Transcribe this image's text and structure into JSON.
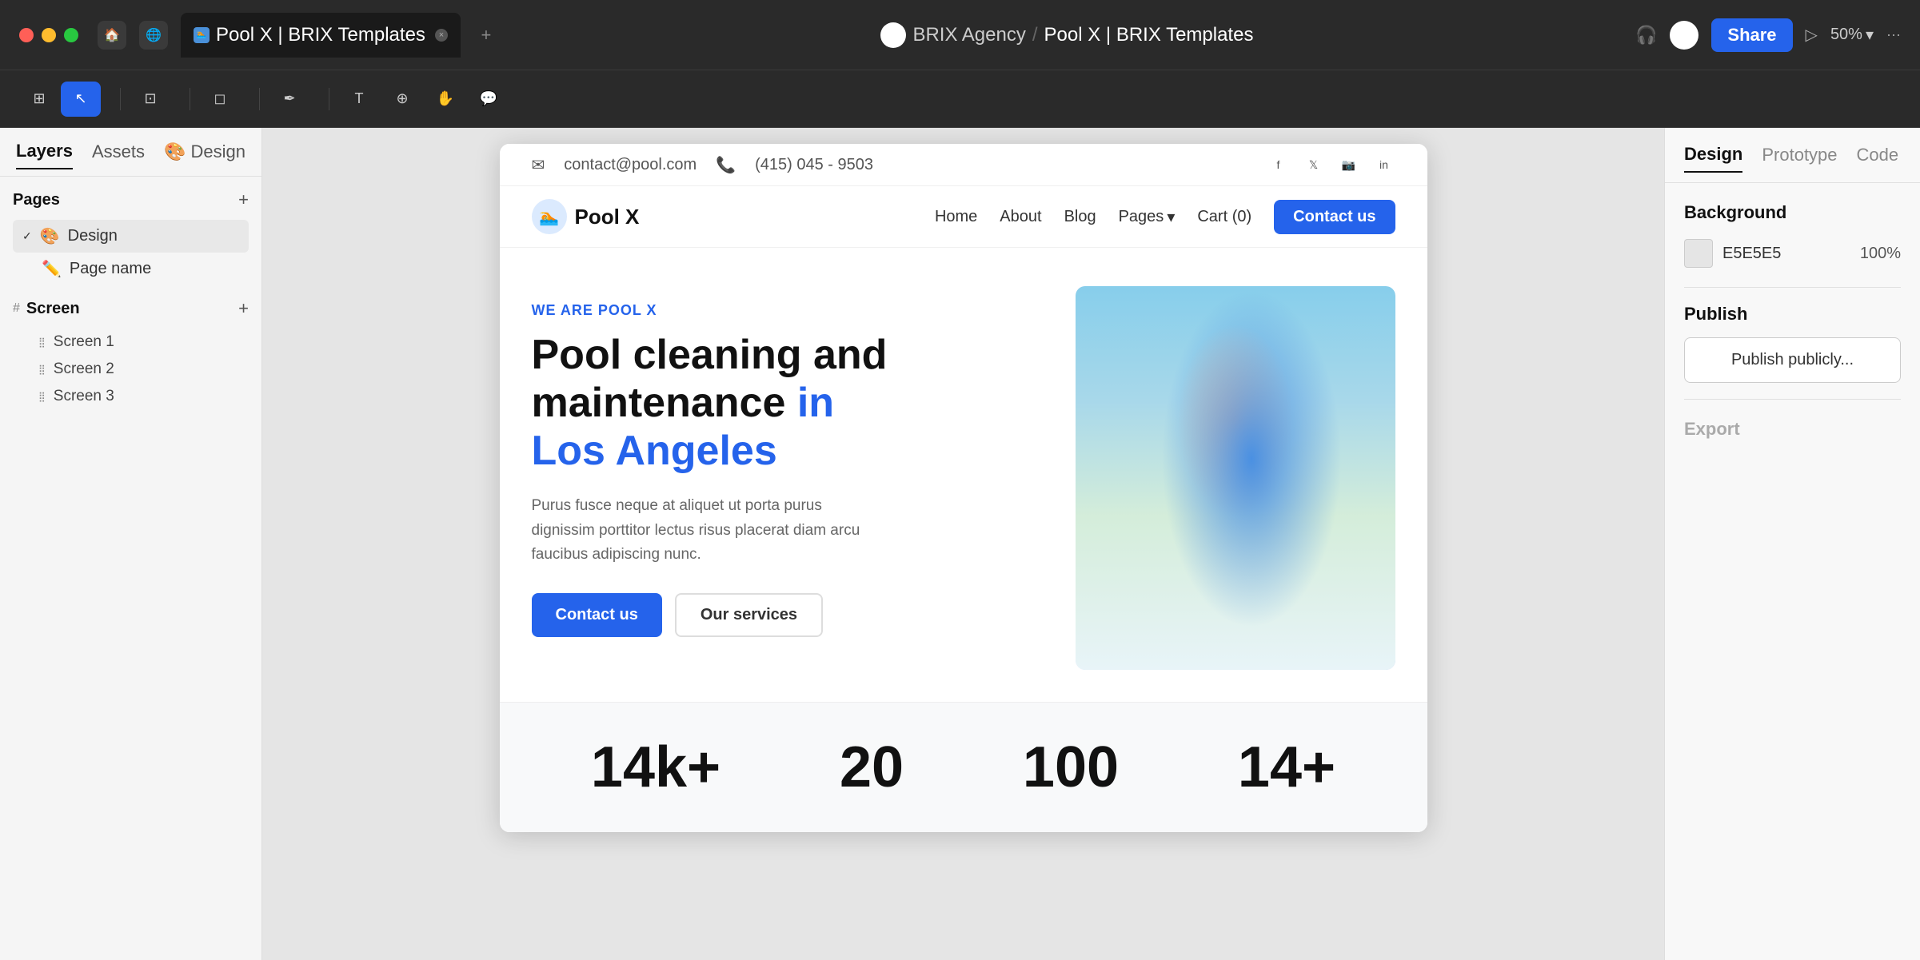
{
  "titlebar": {
    "tab_title": "Pool X | BRIX Templates",
    "tab_close": "×",
    "tab_add": "+",
    "breadcrumb_workspace": "BRIX Agency",
    "breadcrumb_sep": "/",
    "breadcrumb_page": "Pool X | BRIX Templates",
    "share_label": "Share",
    "zoom_label": "50%",
    "more": "···"
  },
  "toolbar": {
    "tools": [
      "grid",
      "cursor",
      "frame",
      "shape",
      "pen",
      "text",
      "components",
      "hand",
      "comment"
    ]
  },
  "sidebar": {
    "tabs": [
      "Layers",
      "Assets",
      "Design"
    ],
    "active_tab": "Layers",
    "pages_label": "Pages",
    "pages_add": "+",
    "design_page_label": "Design",
    "page_name_label": "Page name",
    "screen_label": "Screen",
    "screens": [
      "Screen 1",
      "Screen 2",
      "Screen 3"
    ]
  },
  "canvas": {
    "site": {
      "topbar": {
        "email": "contact@pool.com",
        "phone": "(415) 045 - 9503"
      },
      "navbar": {
        "logo_text": "Pool X",
        "nav_links": [
          "Home",
          "About",
          "Blog",
          "Pages",
          "Cart (0)"
        ],
        "contact_btn": "Contact us"
      },
      "hero": {
        "tag": "WE ARE POOL X",
        "h1_line1": "Pool cleaning and",
        "h1_line2": "maintenance",
        "h1_blue": "in",
        "h1_location": "Los Angeles",
        "desc": "Purus fusce neque at aliquet ut porta purus dignissim porttitor lectus risus placerat diam arcu faucibus adipiscing nunc.",
        "btn_primary": "Contact us",
        "btn_secondary": "Our services"
      },
      "stats": [
        {
          "number": "14k+",
          "label": ""
        },
        {
          "number": "20",
          "label": ""
        },
        {
          "number": "100",
          "label": ""
        },
        {
          "number": "14+",
          "label": ""
        }
      ]
    }
  },
  "right_panel": {
    "tabs": [
      "Design",
      "Prototype",
      "Code"
    ],
    "active_tab": "Design",
    "background_label": "Background",
    "bg_color": "E5E5E5",
    "bg_opacity": "100%",
    "publish_label": "Publish",
    "publish_btn": "Publish publicly...",
    "export_label": "Export"
  }
}
